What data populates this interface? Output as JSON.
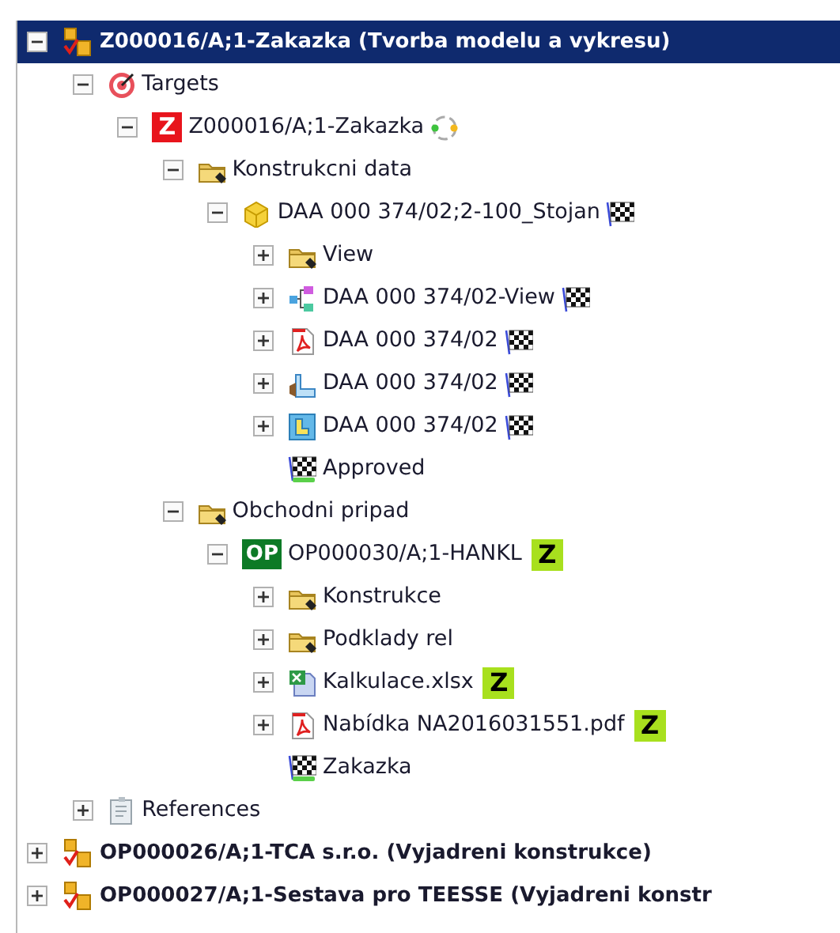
{
  "tree": [
    {
      "label": "Z000016/A;1-Zakazka (Tvorba modelu a vykresu)",
      "kind": "workflow",
      "expanded": true,
      "selected": true,
      "children": [
        {
          "label": "Targets",
          "kind": "target",
          "expanded": true,
          "selected": false,
          "children": [
            {
              "label": "Z000016/A;1-Zakazka",
              "kind": "letter-red",
              "icon_text": "Z",
              "marker": {
                "kind": "cycle"
              },
              "expanded": true,
              "selected": false,
              "children": [
                {
                  "label": "Konstrukcni data",
                  "kind": "folder",
                  "expanded": true,
                  "selected": false,
                  "children": [
                    {
                      "label": "DAA 000 374/02;2-100_Stojan",
                      "kind": "cube",
                      "marker": {
                        "kind": "flag"
                      },
                      "expanded": true,
                      "selected": false,
                      "children": [
                        {
                          "label": "View",
                          "kind": "folder",
                          "expanded": false,
                          "selected": false
                        },
                        {
                          "label": "DAA 000 374/02-View",
                          "kind": "view",
                          "marker": {
                            "kind": "flag"
                          },
                          "expanded": false,
                          "selected": false
                        },
                        {
                          "label": "DAA 000 374/02",
                          "kind": "pdf",
                          "marker": {
                            "kind": "flag"
                          },
                          "expanded": false,
                          "selected": false
                        },
                        {
                          "label": "DAA 000 374/02",
                          "kind": "drawing",
                          "marker": {
                            "kind": "flag"
                          },
                          "expanded": false,
                          "selected": false
                        },
                        {
                          "label": "DAA 000 374/02",
                          "kind": "part",
                          "marker": {
                            "kind": "flag"
                          },
                          "expanded": false,
                          "selected": false
                        },
                        {
                          "label": "Approved",
                          "kind": "status",
                          "selected": false
                        }
                      ]
                    }
                  ]
                },
                {
                  "label": "Obchodni pripad",
                  "kind": "folder",
                  "expanded": true,
                  "selected": false,
                  "children": [
                    {
                      "label": "OP000030/A;1-HANKL",
                      "kind": "letter-green",
                      "icon_text": "OP",
                      "badge": "Z",
                      "expanded": true,
                      "selected": false,
                      "children": [
                        {
                          "label": "Konstrukce",
                          "kind": "folder",
                          "expanded": false,
                          "selected": false
                        },
                        {
                          "label": "Podklady rel",
                          "kind": "folder",
                          "expanded": false,
                          "selected": false
                        },
                        {
                          "label": "Kalkulace.xlsx",
                          "kind": "excel",
                          "badge": "Z",
                          "expanded": false,
                          "selected": false
                        },
                        {
                          "label": "Nabídka NA2016031551.pdf",
                          "kind": "pdf",
                          "badge": "Z",
                          "expanded": false,
                          "selected": false
                        },
                        {
                          "label": "Zakazka",
                          "kind": "status",
                          "selected": false
                        }
                      ]
                    }
                  ]
                }
              ]
            }
          ]
        },
        {
          "label": "References",
          "kind": "references",
          "expanded": false,
          "selected": false
        }
      ]
    },
    {
      "label": "OP000026/A;1-TCA s.r.o. (Vyjadreni konstrukce)",
      "kind": "workflow",
      "expanded": false,
      "selected": false
    },
    {
      "label": "OP000027/A;1-Sestava pro TEESSE (Vyjadreni konstr",
      "kind": "workflow",
      "expanded": false,
      "selected": false
    }
  ]
}
